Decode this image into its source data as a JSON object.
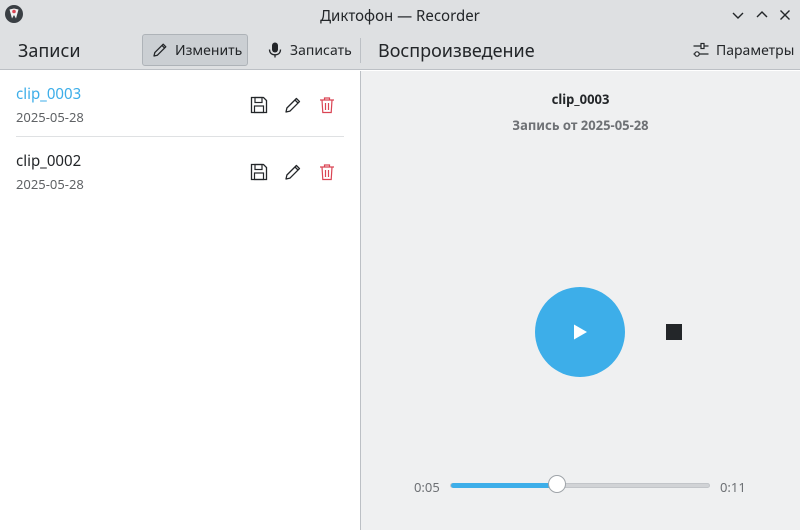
{
  "window": {
    "title": "Диктофон — Recorder",
    "icon": "recorder-app-icon",
    "controls": [
      "minimize-icon",
      "maximize-icon",
      "close-icon"
    ]
  },
  "toolbar": {
    "left_title": "Записи",
    "edit_label": "Изменить",
    "record_label": "Записать",
    "right_title": "Воспроизведение",
    "settings_label": "Параметры"
  },
  "recordings": [
    {
      "name": "clip_0003",
      "date": "2025-05-28",
      "selected": true
    },
    {
      "name": "clip_0002",
      "date": "2025-05-28",
      "selected": false
    }
  ],
  "row_actions": [
    "save-icon",
    "edit-icon",
    "delete-icon"
  ],
  "player": {
    "title": "clip_0003",
    "subtitle": "Запись от 2025-05-28",
    "current_time": "0:05",
    "total_time": "0:11",
    "progress": 0.41
  },
  "colors": {
    "accent": "#3daee9",
    "delete": "#da4453",
    "header_bg": "#dee0e2",
    "player_bg": "#eff0f1"
  }
}
